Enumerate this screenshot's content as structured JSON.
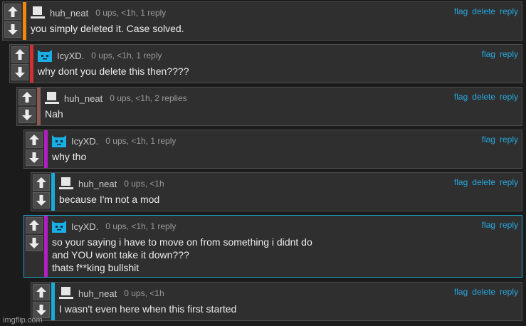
{
  "colors": {
    "page_bg": "#1b1b1b",
    "comment_bg": "#2f2f2f",
    "link": "#27a8e0",
    "bar_orange": "#f0890a",
    "bar_red": "#d22f2f",
    "bar_brown": "#8b5a55",
    "bar_purple": "#b21fbf",
    "bar_cyan": "#1aa9d8"
  },
  "comments": [
    {
      "user": "huh_neat",
      "avatar": "default-user-icon",
      "meta": "0 ups, <1h, 1 reply",
      "actions": [
        "flag",
        "delete",
        "reply"
      ],
      "text": "you simply deleted it. Case solved."
    },
    {
      "user": "IcyXD.",
      "avatar": "blue-cat-icon",
      "meta": "0 ups, <1h, 1 reply",
      "actions": [
        "flag",
        "reply"
      ],
      "text": "why dont you delete this then????"
    },
    {
      "user": "huh_neat",
      "avatar": "default-user-icon",
      "meta": "0 ups, <1h, 2 replies",
      "actions": [
        "flag",
        "delete",
        "reply"
      ],
      "text": "Nah"
    },
    {
      "user": "IcyXD.",
      "avatar": "blue-cat-icon",
      "meta": "0 ups, <1h, 1 reply",
      "actions": [
        "flag",
        "reply"
      ],
      "text": "why tho"
    },
    {
      "user": "huh_neat",
      "avatar": "default-user-icon",
      "meta": "0 ups, <1h",
      "actions": [
        "flag",
        "delete",
        "reply"
      ],
      "text": "because I'm not a mod"
    },
    {
      "user": "IcyXD.",
      "avatar": "blue-cat-icon",
      "meta": "0 ups, <1h, 1 reply",
      "actions": [
        "flag",
        "reply"
      ],
      "text": "so your saying i have to move on from something i didnt do\nand YOU wont take it down???\nthats f**king bullshit"
    },
    {
      "user": "huh_neat",
      "avatar": "default-user-icon",
      "meta": "0 ups, <1h",
      "actions": [
        "flag",
        "delete",
        "reply"
      ],
      "text": "I wasn't even here when this first started"
    }
  ],
  "watermark": "imgflip.com"
}
